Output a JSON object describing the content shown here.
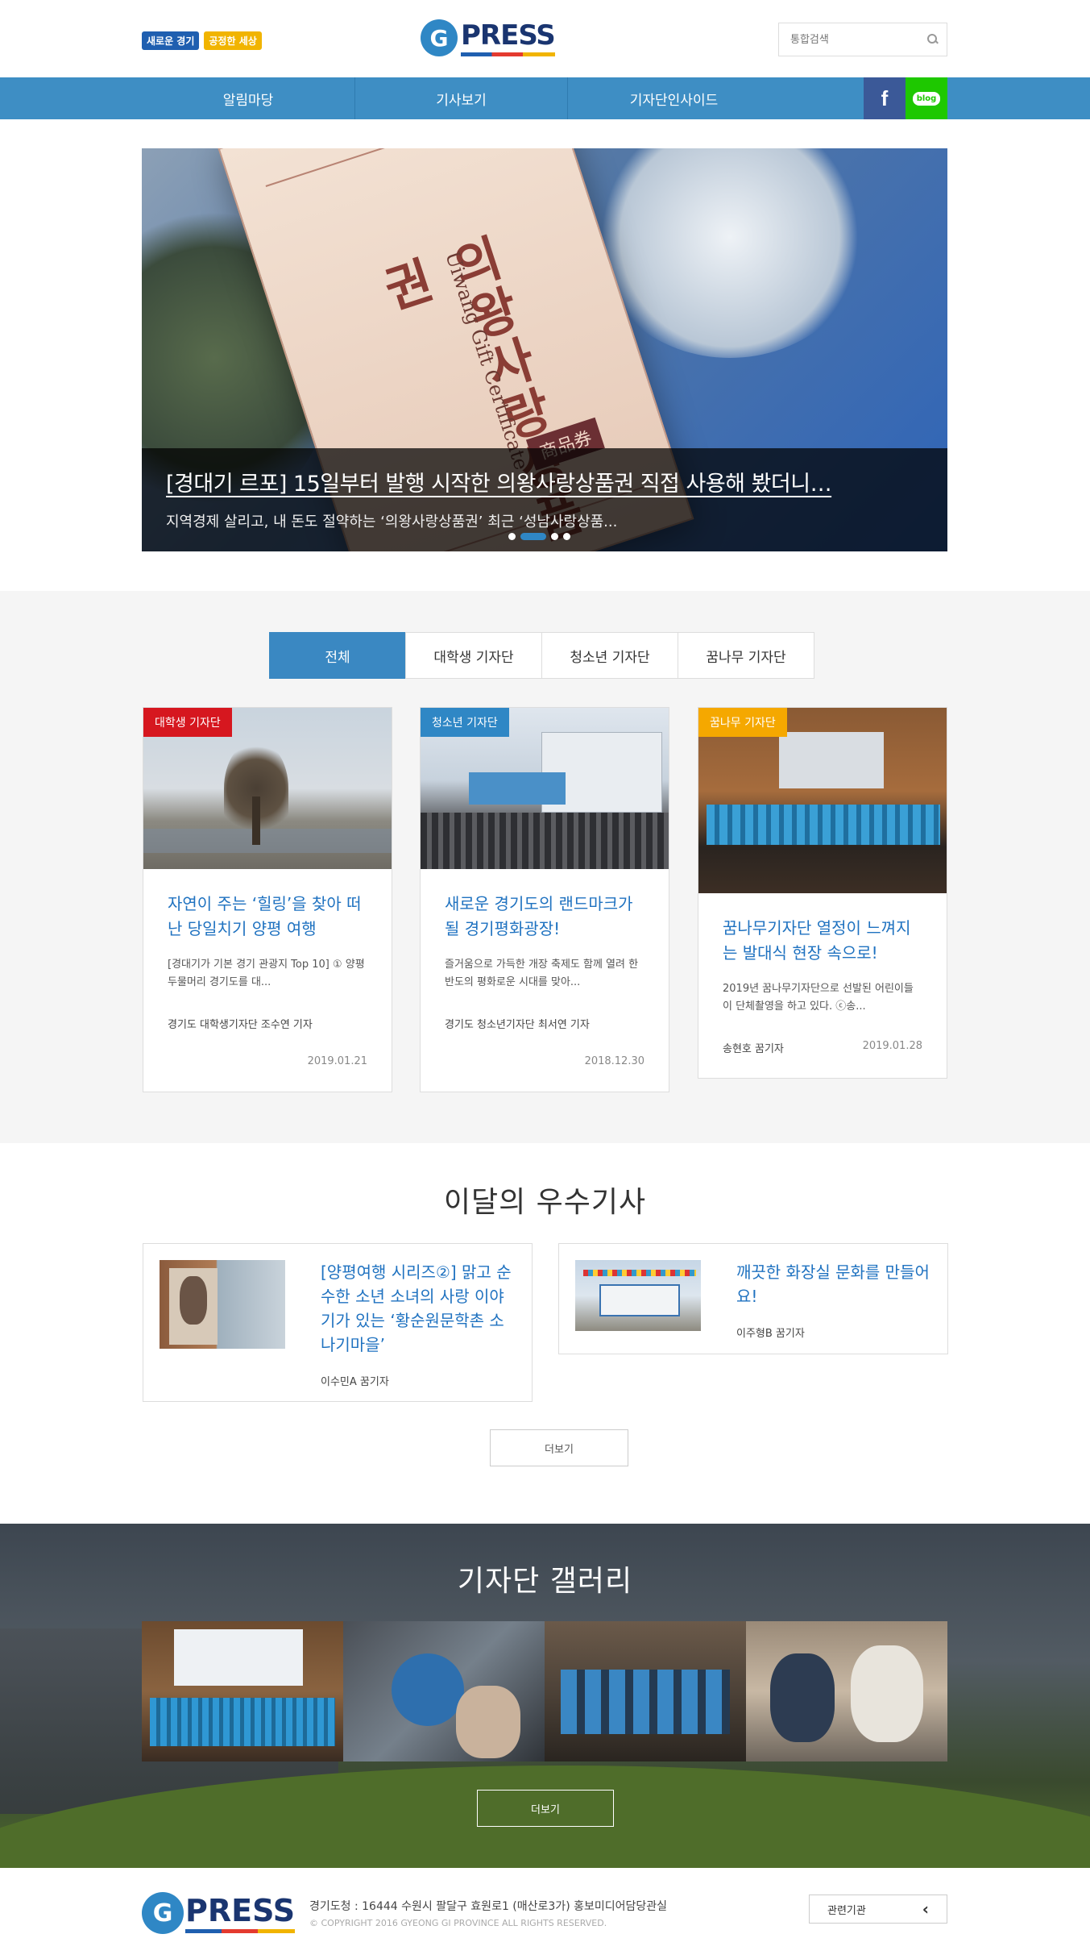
{
  "header": {
    "slogan_part1": "새로운 경기",
    "slogan_part2": "공정한 세상",
    "logo_letter": "G",
    "logo_text": "PRESS",
    "search_placeholder": "통합검색"
  },
  "nav": {
    "items": [
      {
        "label": "알림마당"
      },
      {
        "label": "기사보기"
      },
      {
        "label": "기자단인사이드"
      }
    ],
    "facebook_glyph": "f",
    "blog_label": "blog"
  },
  "hero": {
    "title": "[경대기 르포] 15일부터 발행 시작한 의왕사랑상품권 직접 사용해 봤더니…",
    "desc": "지역경제 살리고, 내 돈도 절약하는 ‘의왕사랑상품권’ 최근 ‘성남사랑상품...",
    "ticket_text": "의왕사랑상품권",
    "ticket_en": "Uiwang Gift Certificate",
    "ticket_stamp": "商品券",
    "slides": 4,
    "active_slide": 2
  },
  "tabs": [
    {
      "label": "전체",
      "active": true
    },
    {
      "label": "대학생 기자단",
      "active": false
    },
    {
      "label": "청소년 기자단",
      "active": false
    },
    {
      "label": "꿈나무 기자단",
      "active": false
    }
  ],
  "cards": [
    {
      "badge": "대학생 기자단",
      "badge_color": "#d6171f",
      "title": "자연이 주는 ‘힐링’을 찾아 떠난 당일치기 양평 여행",
      "summary": "[경대기가 기본 경기 관광지 Top 10] ① 양평 두물머리 경기도를 대...",
      "author": "경기도 대학생기자단 조수연 기자",
      "date": "2019.01.21"
    },
    {
      "badge": "청소년 기자단",
      "badge_color": "#2f87c5",
      "title": "새로운 경기도의 랜드마크가 될 경기평화광장!",
      "summary": "즐거움으로 가득한 개장 축제도 함께 열려 한반도의 평화로운 시대를 맞아...",
      "author": "경기도 청소년기자단 최서연 기자",
      "date": "2018.12.30"
    },
    {
      "badge": "꿈나무 기자단",
      "badge_color": "#f5a800",
      "title": "꿈나무기자단 열정이 느껴지는 발대식 현장 속으로!",
      "summary": "2019년 꿈나무기자단으로 선발된 어린이들이 단체촬영을 하고 있다. ⓒ송...",
      "author": "송현호 꿈기자",
      "date": "2019.01.28"
    }
  ],
  "best": {
    "heading": "이달의 우수기사",
    "items": [
      {
        "title": "[양평여행 시리즈②] 맑고 순수한 소년 소녀의 사랑 이야기가 있는 ‘황순원문학촌 소나기마을’",
        "author": "이수민A 꿈기자"
      },
      {
        "title": "깨끗한 화장실 문화를 만들어요!",
        "author": "이주형B 꿈기자"
      }
    ],
    "more_label": "더보기"
  },
  "gallery": {
    "heading": "기자단 갤러리",
    "more_label": "더보기"
  },
  "footer": {
    "address": "경기도청 : 16444 수원시 팔달구 효원로1 (매산로3가) 홍보미디어담당관실",
    "copyright": "© COPYRIGHT 2016 GYEONG GI PROVINCE ALL RIGHTS RESERVED.",
    "related_label": "관련기관",
    "related_arrow": "‹"
  }
}
